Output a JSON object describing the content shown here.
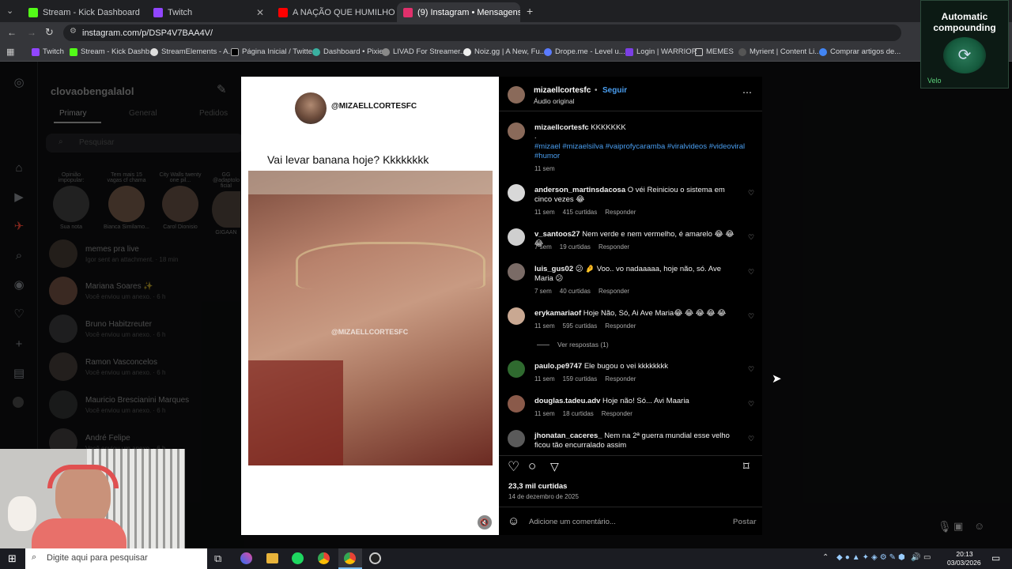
{
  "browser": {
    "tabs": [
      {
        "label": "Stream - Kick Dashboard",
        "color": "#53fc18"
      },
      {
        "label": "Twitch",
        "color": "#9146ff"
      },
      {
        "label": "A NAÇÃO QUE HUMILHOU OS",
        "color": "#ff0000"
      },
      {
        "label": "(9) Instagram • Mensagens",
        "color": "#e1306c"
      }
    ],
    "url": "instagram.com/p/DSP4V7BAA4V/",
    "bookmarks": [
      "Twitch",
      "Stream - Kick Dashb...",
      "StreamElements - A...",
      "Página Inicial / Twitter",
      "Dashboard • Pixie",
      "LIVAD For Streamer...",
      "Noiz.gg | A New, Fu...",
      "Drope.me - Level u...",
      "Login | WARRIOR",
      "MEMES",
      "Myrient | Content Li...",
      "Comprar artigos de..."
    ]
  },
  "dm": {
    "username": "clovaobengalalol",
    "tabs": [
      "Primary",
      "General",
      "Pedidos"
    ],
    "search_placeholder": "Pesquisar",
    "stories": [
      {
        "note": "Opinião impopular:",
        "name": "Sua nota"
      },
      {
        "note": "Tem mais 15 vagas cf chama",
        "name": "Bianca Similamo..."
      },
      {
        "note": "City Walls twenty one pil...",
        "name": "Carol Dionisio"
      },
      {
        "note": "GG @adaptolo ficial",
        "name": "GIGAAN"
      }
    ],
    "threads": [
      {
        "name": "memes pra live",
        "sub": "Igor sent an attachment. · 18 min"
      },
      {
        "name": "Mariana Soares ✨",
        "sub": "Você enviou um anexo. · 6 h"
      },
      {
        "name": "Bruno Habitzreuter",
        "sub": "Você enviou um anexo. · 6 h"
      },
      {
        "name": "Ramon Vasconcelos",
        "sub": "Você enviou um anexo. · 6 h"
      },
      {
        "name": "Mauricio Brescianini Marques",
        "sub": "Você enviou um anexo. · 6 h"
      },
      {
        "name": "André Felipe",
        "sub": "Você enviou um anexo. · 6 h"
      }
    ]
  },
  "post": {
    "header_handle": "@MIZAELLCORTESFC",
    "caption_text": "Vai levar banana hoje? Kkkkkkkk",
    "watermark": "@MIZAELLCORTESFC",
    "author": "mizaellcortesfc",
    "follow": "Seguir",
    "audio": "Áudio original",
    "author_comment": "KKKKKKK",
    "dot": ".",
    "hashtags": "#mizael #mizaelsilva #vaiprofycaramba #viralvideos #videoviral #humor",
    "caption_time": "11 sem",
    "comments": [
      {
        "user": "anderson_martinsdacosa",
        "text": "O véi Reiniciou o sistema em cinco vezes 😂",
        "time": "11 sem",
        "likes": "415 curtidas",
        "reply": "Responder"
      },
      {
        "user": "v_santoos27",
        "text": "Nem verde e nem vermelho, é amarelo 😂 😂 😂",
        "time": "7 sem",
        "likes": "19 curtidas",
        "reply": "Responder"
      },
      {
        "user": "luis_gus02",
        "text": "😕 🤌 Voo.. vo nadaaaaa, hoje não, só. Ave Maria 😕",
        "time": "7 sem",
        "likes": "40 curtidas",
        "reply": "Responder"
      },
      {
        "user": "erykamariaof",
        "text": "Hoje Não, Só, Ai Ave Maria😂 😂 😂 😂 😂",
        "time": "11 sem",
        "likes": "595 curtidas",
        "reply": "Responder"
      },
      {
        "user": "paulo.pe9747",
        "text": "Ele bugou o vei kkkkkkkk",
        "time": "11 sem",
        "likes": "159 curtidas",
        "reply": "Responder"
      },
      {
        "user": "douglas.tadeu.adv",
        "text": "Hoje não! Só... Avi Maaria",
        "time": "11 sem",
        "likes": "18 curtidas",
        "reply": "Responder"
      },
      {
        "user": "jhonatan_caceres_",
        "text": "Nem na 2ª guerra mundial esse velho ficou tão encurralado assim",
        "time": "",
        "likes": "",
        "reply": ""
      }
    ],
    "view_replies": "Ver respostas (1)",
    "likes_total": "23,3 mil curtidas",
    "date": "14 de dezembro de 2025",
    "comment_placeholder": "Adicione um comentário...",
    "post_button": "Postar"
  },
  "widget": {
    "title": "Automatic compounding",
    "brand": "Velo"
  },
  "taskbar": {
    "search": "Digite aqui para pesquisar",
    "time": "20:13",
    "date": "03/03/2026"
  }
}
